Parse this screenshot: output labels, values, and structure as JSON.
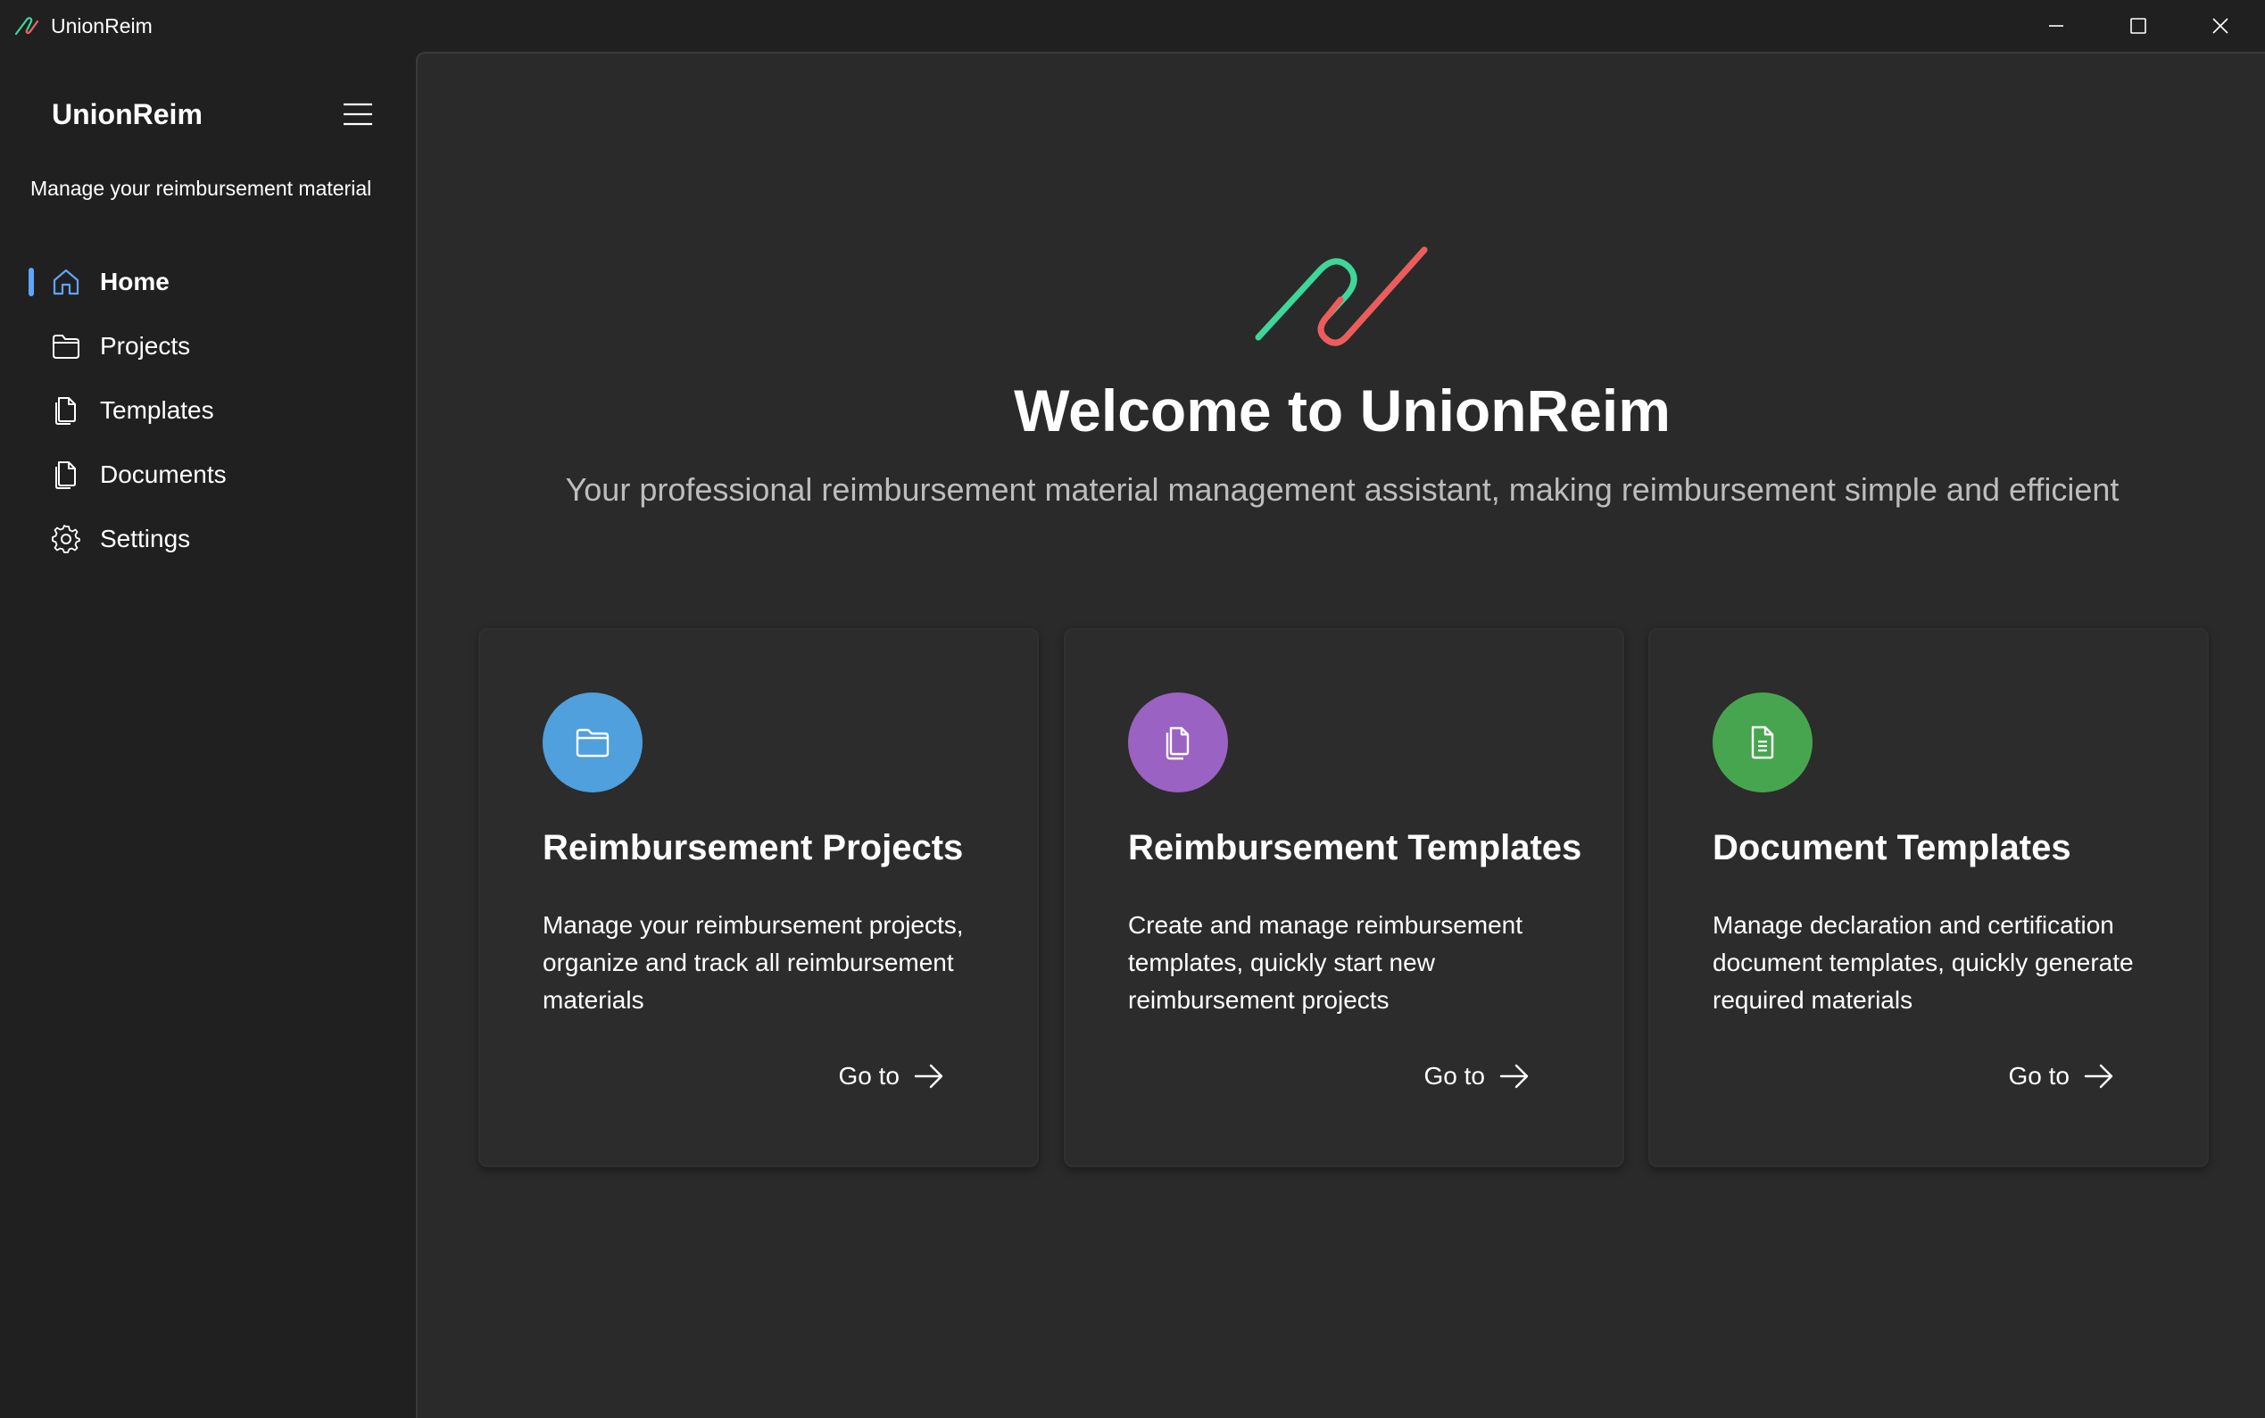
{
  "window": {
    "title": "UnionReim",
    "controls": [
      "minimize-icon",
      "maximize-icon",
      "close-icon"
    ]
  },
  "sidebar": {
    "brand": "UnionReim",
    "tagline": "Manage your reimbursement material",
    "items": [
      {
        "label": "Home",
        "icon": "home-icon",
        "active": true
      },
      {
        "label": "Projects",
        "icon": "folder-icon"
      },
      {
        "label": "Templates",
        "icon": "document-copy-icon"
      },
      {
        "label": "Documents",
        "icon": "document-copy-icon"
      },
      {
        "label": "Settings",
        "icon": "gear-icon"
      }
    ]
  },
  "main": {
    "welcome": "Welcome to UnionReim",
    "subtitle": "Your professional reimbursement material management assistant, making reimbursement simple and efficient",
    "cards": [
      {
        "title": "Reimbursement Projects",
        "description": "Manage your reimbursement projects, organize and track all reimbursement materials",
        "action": "Go to",
        "icon": "folder-icon",
        "color": "#4fa0dc"
      },
      {
        "title": "Reimbursement Templates",
        "description": "Create and manage reimbursement templates, quickly start new reimbursement projects",
        "action": "Go to",
        "icon": "document-copy-icon",
        "color": "#9a62c2"
      },
      {
        "title": "Document Templates",
        "description": "Manage declaration and certification document templates, quickly generate required materials",
        "action": "Go to",
        "icon": "document-text-icon",
        "color": "#48a54f"
      }
    ]
  },
  "colors": {
    "accent": "#60a5fa",
    "logo_green": "#3fd69a",
    "logo_red": "#ef5b5b"
  }
}
